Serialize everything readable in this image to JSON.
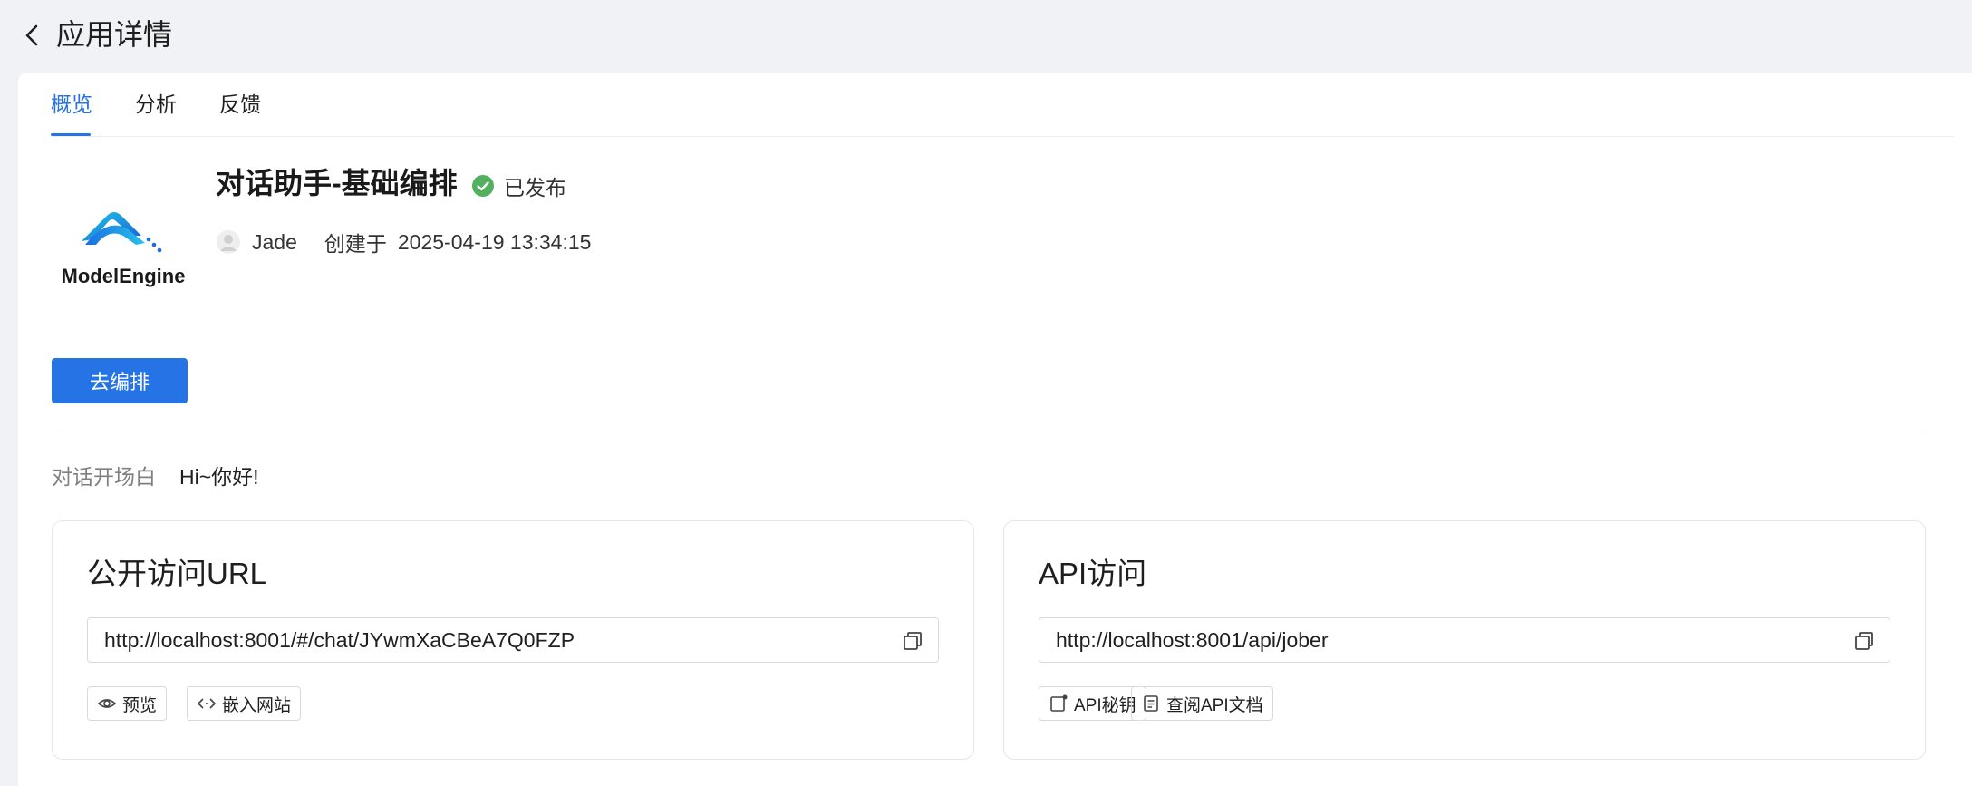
{
  "header": {
    "title": "应用详情"
  },
  "tabs": [
    {
      "label": "概览",
      "active": true
    },
    {
      "label": "分析",
      "active": false
    },
    {
      "label": "反馈",
      "active": false
    }
  ],
  "app": {
    "logo_text": "ModelEngine",
    "name": "对话助手-基础编排",
    "status": "已发布",
    "author": "Jade",
    "created_label": "创建于",
    "created_at": "2025-04-19 13:34:15"
  },
  "actions": {
    "edit_label": "去编排"
  },
  "opening": {
    "label": "对话开场白",
    "value": "Hi~你好!"
  },
  "public_access": {
    "title": "公开访问URL",
    "url": "http://localhost:8001/#/chat/JYwmXaCBeA7Q0FZP",
    "preview_label": "预览",
    "embed_label": "嵌入网站"
  },
  "api_access": {
    "title": "API访问",
    "url": "http://localhost:8001/api/jober",
    "key_label": "API秘钥",
    "docs_label": "查阅API文档"
  },
  "colors": {
    "accent": "#2673e5",
    "status_green": "#52c41a",
    "background": "#f0f2f5"
  }
}
